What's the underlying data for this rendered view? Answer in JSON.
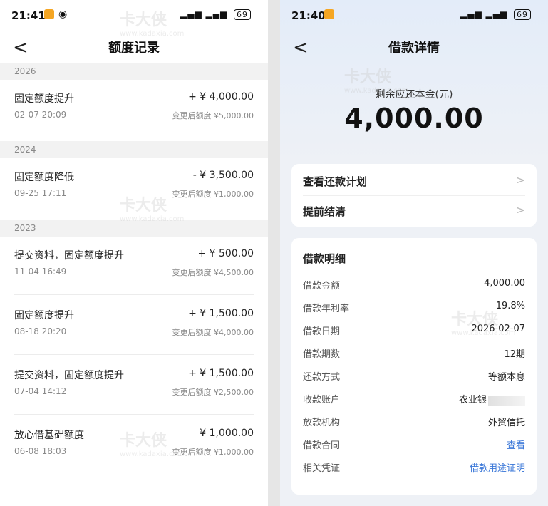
{
  "left": {
    "status": {
      "time": "21:41",
      "battery": "69"
    },
    "nav": {
      "back": "<",
      "title": "额度记录"
    },
    "groups": [
      {
        "year": "2026",
        "records": [
          {
            "title": "固定额度提升",
            "amount": "+ ¥ 4,000.00",
            "time": "02-07 20:09",
            "after": "变更后额度 ¥5,000.00"
          }
        ]
      },
      {
        "year": "2024",
        "records": [
          {
            "title": "固定额度降低",
            "amount": "- ¥ 3,500.00",
            "time": "09-25 17:11",
            "after": "变更后额度 ¥1,000.00"
          }
        ]
      },
      {
        "year": "2023",
        "records": [
          {
            "title": "提交资料，固定额度提升",
            "amount": "+ ¥ 500.00",
            "time": "11-04 16:49",
            "after": "变更后额度 ¥4,500.00"
          },
          {
            "title": "固定额度提升",
            "amount": "+ ¥ 1,500.00",
            "time": "08-18 20:20",
            "after": "变更后额度 ¥4,000.00"
          },
          {
            "title": "提交资料，固定额度提升",
            "amount": "+ ¥ 1,500.00",
            "time": "07-04 14:12",
            "after": "变更后额度 ¥2,500.00"
          },
          {
            "title": "放心借基础额度",
            "amount": "¥ 1,000.00",
            "time": "06-08 18:03",
            "after": "变更后额度 ¥1,000.00"
          }
        ]
      }
    ]
  },
  "right": {
    "status": {
      "time": "21:40",
      "battery": "69"
    },
    "nav": {
      "back": "<",
      "title": "借款详情"
    },
    "remain_label": "剩余应还本金(元)",
    "remain_value": "4,000.00",
    "menu": [
      {
        "label": "查看还款计划",
        "chevron": ">"
      },
      {
        "label": "提前结清",
        "chevron": ">"
      }
    ],
    "detail_title": "借款明细",
    "details": [
      {
        "label": "借款金额",
        "value": "4,000.00"
      },
      {
        "label": "借款年利率",
        "value": "19.8%"
      },
      {
        "label": "借款日期",
        "value": "2026-02-07"
      },
      {
        "label": "借款期数",
        "value": "12期"
      },
      {
        "label": "还款方式",
        "value": "等额本息"
      },
      {
        "label": "收款账户",
        "value": "农业银"
      },
      {
        "label": "放款机构",
        "value": "外贸信托"
      },
      {
        "label": "借款合同",
        "value": "查看"
      },
      {
        "label": "相关凭证",
        "value": "借款用途证明"
      }
    ]
  },
  "watermark": {
    "brand": "卡大侠",
    "url": "www.kadaxia.com"
  },
  "colors": {
    "link": "#3a77d8",
    "year_bar": "#f2f2f2",
    "right_bg": "#eef1f6"
  }
}
